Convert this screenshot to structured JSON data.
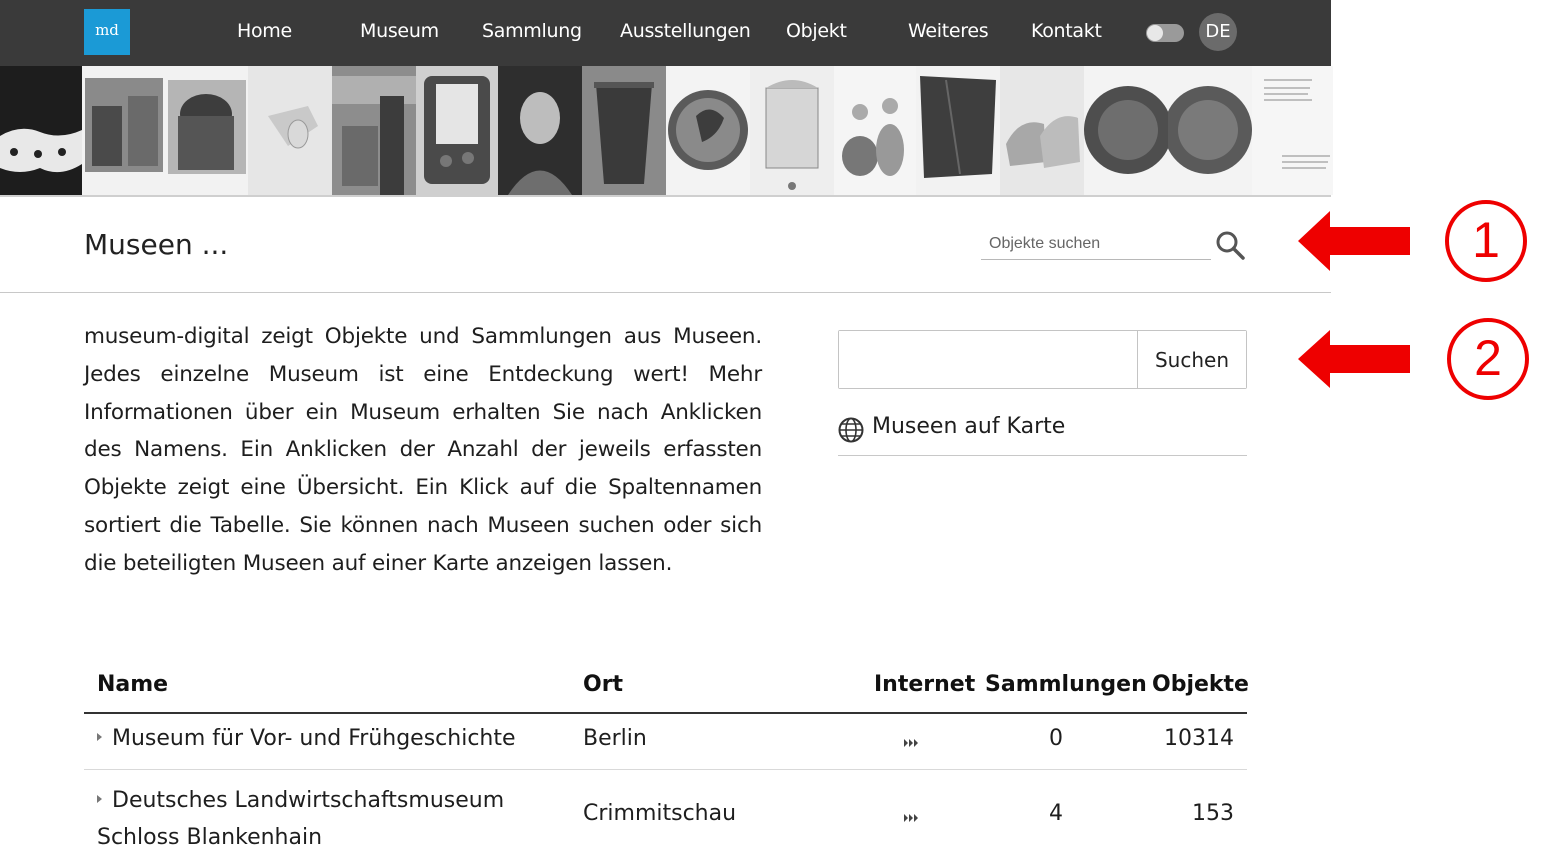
{
  "nav": {
    "logo": "md",
    "items": [
      "Home",
      "Museum",
      "Sammlung",
      "Ausstellungen",
      "Objekt",
      "Weiteres",
      "Kontakt"
    ],
    "lang": "DE"
  },
  "header": {
    "title": "Museen ...",
    "search_placeholder": "Objekte suchen"
  },
  "annotations": {
    "first": "1",
    "second": "2"
  },
  "intro": {
    "text": "museum-digital zeigt Objekte und Sammlungen aus Museen. Jedes einzelne Museum ist eine Entdeckung wert! Mehr Informationen über ein Museum erhalten Sie nach Anklicken des Namens. Ein Anklicken der Anzahl der jeweils erfassten Objekte zeigt eine Übersicht. Ein Klick auf die Spaltennamen sortiert die Tabelle. Sie können nach Museen suchen oder sich die beteiligten Museen auf einer Karte anzeigen lassen."
  },
  "museum_search": {
    "value": "",
    "button": "Suchen"
  },
  "map_link": {
    "label": "Museen auf Karte",
    "icon": "globe-icon"
  },
  "table": {
    "headers": {
      "name": "Name",
      "ort": "Ort",
      "internet": "Internet",
      "sammlungen": "Sammlungen",
      "objekte": "Objekte"
    },
    "rows": [
      {
        "name": "Museum für Vor- und Frühgeschichte",
        "ort": "Berlin",
        "sammlungen": "0",
        "objekte": "10314"
      },
      {
        "name_line1": "Deutsches Landwirtschaftsmuseum",
        "name_line2": "Schloss Blankenhain",
        "ort": "Crimmitschau",
        "sammlungen": "4",
        "objekte": "153"
      }
    ]
  },
  "colors": {
    "topbar": "#3a3a3a",
    "logo": "#1b9ad6",
    "annotation": "#ee0000"
  }
}
